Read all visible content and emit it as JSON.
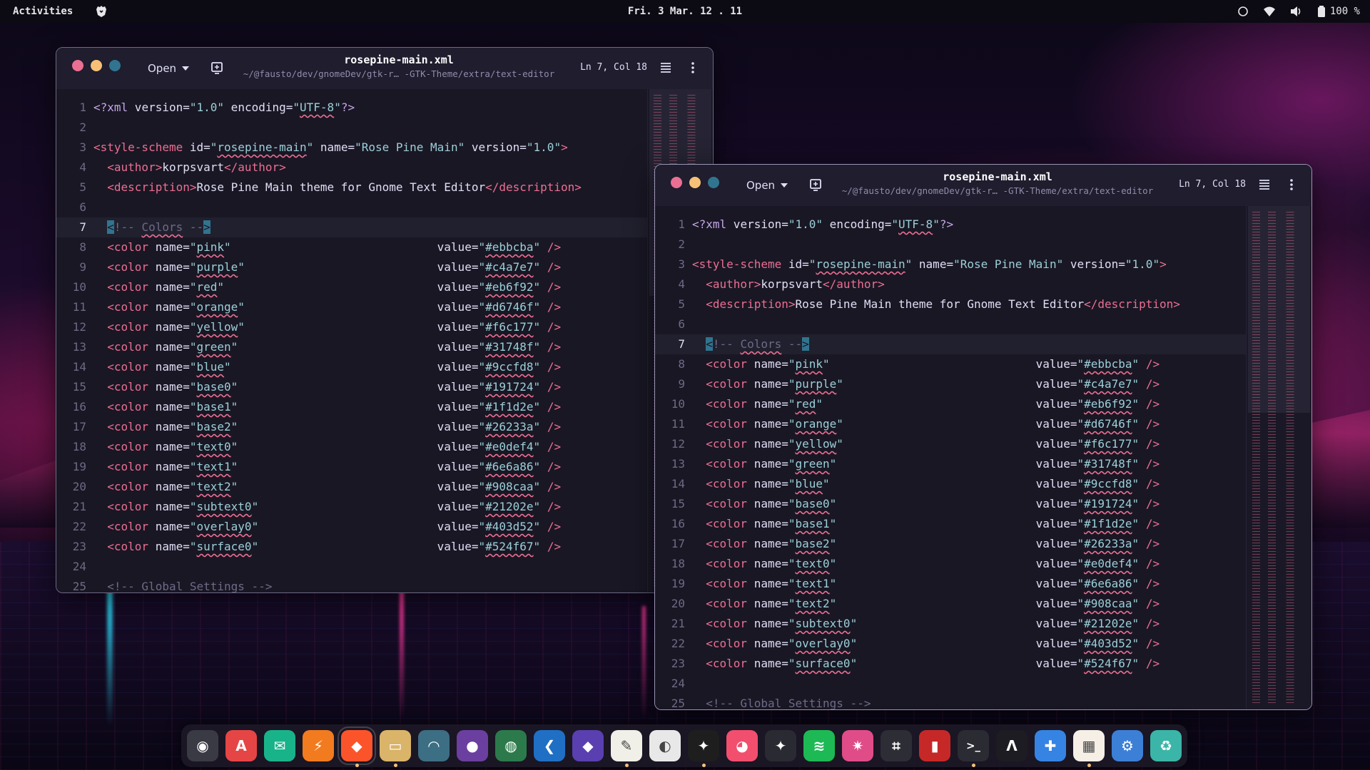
{
  "topbar": {
    "activities": "Activities",
    "clock": "Fri. 3 Mar.  12 . 11",
    "battery": "100 %"
  },
  "windows": [
    {
      "title": "rosepine-main.xml",
      "path": "~/@fausto/dev/gnomeDev/gtk-r… -GTK-Theme/extra/text-editor",
      "open_label": "Open",
      "cursor_pos": "Ln 7, Col 18"
    },
    {
      "title": "rosepine-main.xml",
      "path": "~/@fausto/dev/gnomeDev/gtk-r… -GTK-Theme/extra/text-editor",
      "open_label": "Open",
      "cursor_pos": "Ln 7, Col 18"
    }
  ],
  "code": {
    "xml_decl": {
      "version": "1.0",
      "encoding": "UTF-8"
    },
    "scheme": {
      "id": "rosepine-main",
      "name": "Rose Pine Main",
      "version": "1.0"
    },
    "author": "korpsvart",
    "description": "Rose Pine Main theme for Gnome Text Editor",
    "comment_colors": "Colors",
    "comment_global": "Global Settings",
    "current_line": 7,
    "colors": [
      {
        "name": "pink",
        "value": "#ebbcba"
      },
      {
        "name": "purple",
        "value": "#c4a7e7"
      },
      {
        "name": "red",
        "value": "#eb6f92"
      },
      {
        "name": "orange",
        "value": "#d6746f"
      },
      {
        "name": "yellow",
        "value": "#f6c177"
      },
      {
        "name": "green",
        "value": "#31748f"
      },
      {
        "name": "blue",
        "value": "#9ccfd8"
      },
      {
        "name": "base0",
        "value": "#191724"
      },
      {
        "name": "base1",
        "value": "#1f1d2e"
      },
      {
        "name": "base2",
        "value": "#26233a"
      },
      {
        "name": "text0",
        "value": "#e0def4"
      },
      {
        "name": "text1",
        "value": "#6e6a86"
      },
      {
        "name": "text2",
        "value": "#908caa"
      },
      {
        "name": "subtext0",
        "value": "#21202e"
      },
      {
        "name": "overlay0",
        "value": "#403d52"
      },
      {
        "name": "surface0",
        "value": "#524f67"
      }
    ]
  },
  "theme_colors": {
    "editor_bg": "#191724",
    "titlebar_bg": "#1f1d2e",
    "tag": "#eb6f92",
    "string": "#9ccfd8",
    "comment": "#6e6a86",
    "text": "#e0def4"
  },
  "dock": [
    {
      "id": "penguin-app",
      "glyph": "◉",
      "bg": "#3a3a44",
      "running": false
    },
    {
      "id": "app-center",
      "glyph": "A",
      "bg": "#e64545",
      "running": false
    },
    {
      "id": "mail",
      "glyph": "✉",
      "bg": "#19b38a",
      "running": false
    },
    {
      "id": "flash",
      "glyph": "⚡",
      "bg": "#f27b1f",
      "running": false
    },
    {
      "id": "brave-browser",
      "glyph": "◆",
      "bg": "#fb542b",
      "running": true
    },
    {
      "id": "files",
      "glyph": "▭",
      "bg": "#d9b469",
      "running": true
    },
    {
      "id": "disk-manager",
      "glyph": "◠",
      "bg": "#3c6e84",
      "running": false
    },
    {
      "id": "github-desktop",
      "glyph": "●",
      "bg": "#6b3fa0",
      "running": false
    },
    {
      "id": "globe-app",
      "glyph": "◍",
      "bg": "#2c7a4b",
      "running": false
    },
    {
      "id": "vscode",
      "glyph": "❮",
      "bg": "#1f6fc5",
      "running": false
    },
    {
      "id": "obsidian",
      "glyph": "◆",
      "bg": "#5a3fb0",
      "running": false
    },
    {
      "id": "text-editor",
      "glyph": "✎",
      "bg": "#f0efe8",
      "running": true
    },
    {
      "id": "color-picker",
      "glyph": "◐",
      "bg": "#e8e8e8",
      "running": false
    },
    {
      "id": "figma",
      "glyph": "✦",
      "bg": "#1e1e1e",
      "running": true
    },
    {
      "id": "camera-app",
      "glyph": "◕",
      "bg": "#f24e6e",
      "running": false
    },
    {
      "id": "gnome-tweaks",
      "glyph": "✦",
      "bg": "#2a2a33",
      "running": false
    },
    {
      "id": "spotify",
      "glyph": "≋",
      "bg": "#1db954",
      "running": false
    },
    {
      "id": "kaleidoscope",
      "glyph": "✷",
      "bg": "#e04c88",
      "running": false
    },
    {
      "id": "screenshot",
      "glyph": "⌗",
      "bg": "#2d2d36",
      "running": false
    },
    {
      "id": "audio-visualizer",
      "glyph": "▮",
      "bg": "#c62828",
      "running": false
    },
    {
      "id": "terminal",
      "glyph": ">_",
      "bg": "#2b2b33",
      "running": true
    },
    {
      "id": "alacritty",
      "glyph": "Λ",
      "bg": "#1c1c22",
      "running": false
    },
    {
      "id": "extensions",
      "glyph": "✚",
      "bg": "#3584e4",
      "running": false
    },
    {
      "id": "dconf",
      "glyph": "▦",
      "bg": "#f5efe6",
      "running": true
    },
    {
      "id": "settings",
      "glyph": "⚙",
      "bg": "#3c7fd6",
      "running": false
    },
    {
      "id": "trash",
      "glyph": "♻",
      "bg": "#3bb5a7",
      "running": false
    }
  ]
}
